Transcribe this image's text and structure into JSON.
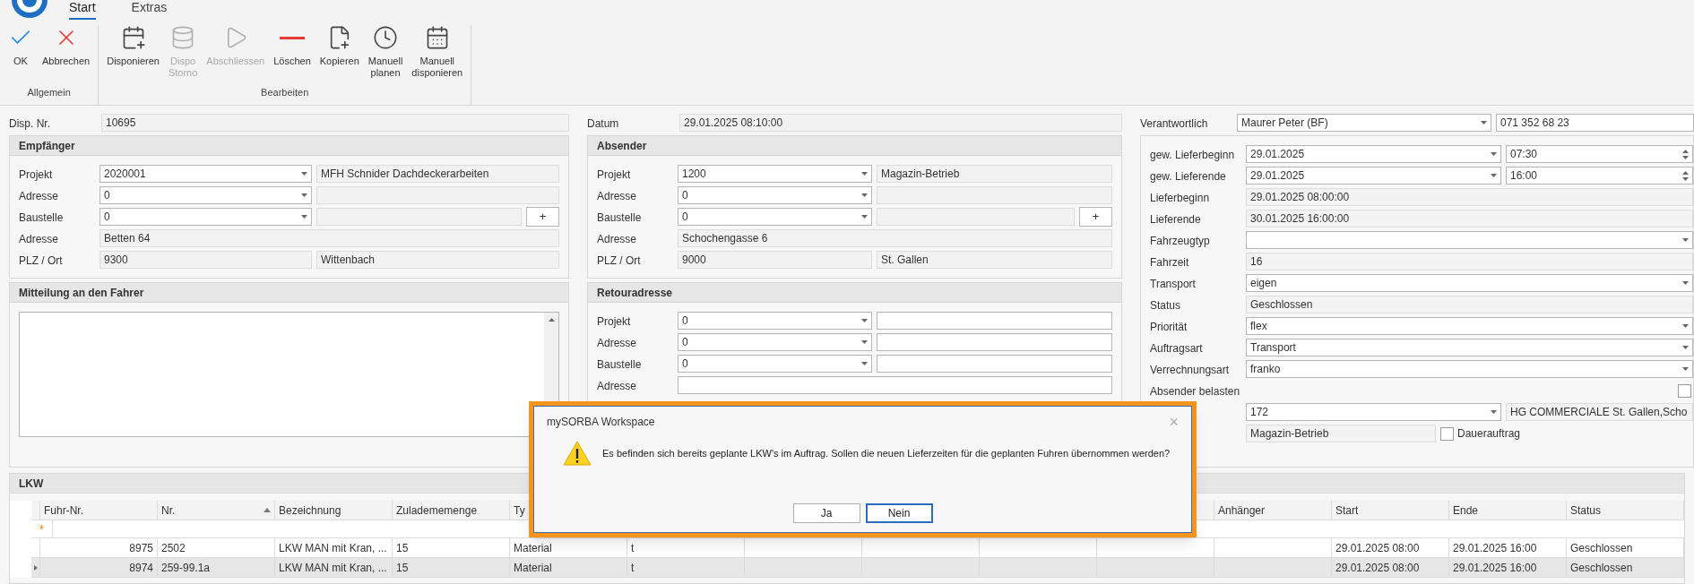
{
  "tabs": [
    {
      "label": "Start",
      "selected": true
    },
    {
      "label": "Extras",
      "selected": false
    }
  ],
  "ribbon": {
    "groups": [
      {
        "label": "Allgemein",
        "buttons": [
          {
            "lines": [
              "OK"
            ],
            "disabled": false
          },
          {
            "lines": [
              "Abbrechen"
            ],
            "disabled": false
          }
        ]
      },
      {
        "label": "Bearbeiten",
        "buttons": [
          {
            "lines": [
              "Disponieren"
            ],
            "disabled": false
          },
          {
            "lines": [
              "Dispo",
              "Storno"
            ],
            "disabled": true
          },
          {
            "lines": [
              "Abschliessen"
            ],
            "disabled": true
          },
          {
            "lines": [
              "Löschen"
            ],
            "disabled": false
          },
          {
            "lines": [
              "Kopieren"
            ],
            "disabled": false
          },
          {
            "lines": [
              "Manuell",
              "planen"
            ],
            "disabled": false
          },
          {
            "lines": [
              "Manuell",
              "disponieren"
            ],
            "disabled": false
          }
        ]
      }
    ]
  },
  "left": {
    "top": {
      "label": "Disp. Nr.",
      "value": "10695"
    },
    "empfaenger": {
      "title": "Empfänger",
      "rows": [
        {
          "label": "Projekt",
          "fields": [
            {
              "kind": "combo",
              "value": "2020001"
            },
            {
              "kind": "readonly",
              "value": "MFH Schnider Dachdeckerarbeiten"
            }
          ]
        },
        {
          "label": "Adresse",
          "fields": [
            {
              "kind": "combo",
              "value": "0"
            },
            {
              "kind": "readonly"
            }
          ]
        },
        {
          "label": "Baustelle",
          "fields": [
            {
              "kind": "combo",
              "value": "0"
            },
            {
              "kind": "readonly"
            }
          ],
          "plus": "+"
        },
        {
          "label": "Adresse",
          "fields": [
            {
              "kind": "readonly",
              "value": "Betten 64"
            }
          ]
        },
        {
          "label": "PLZ / Ort",
          "fields": [
            {
              "kind": "readonly",
              "value": "9300"
            },
            {
              "kind": "readonly",
              "value": "Wittenbach"
            }
          ]
        }
      ]
    },
    "mitteilung": {
      "title": "Mitteilung an den Fahrer"
    }
  },
  "middle": {
    "top": {
      "label": "Datum",
      "value": "29.01.2025 08:10:00"
    },
    "absender": {
      "title": "Absender",
      "rows": [
        {
          "label": "Projekt",
          "fields": [
            {
              "kind": "combo",
              "value": "1200"
            },
            {
              "kind": "readonly",
              "value": "Magazin-Betrieb"
            }
          ]
        },
        {
          "label": "Adresse",
          "fields": [
            {
              "kind": "combo",
              "value": "0"
            },
            {
              "kind": "readonly"
            }
          ]
        },
        {
          "label": "Baustelle",
          "fields": [
            {
              "kind": "combo",
              "value": "0"
            },
            {
              "kind": "readonly"
            }
          ],
          "plus": "+"
        },
        {
          "label": "Adresse",
          "fields": [
            {
              "kind": "readonly",
              "value": "Schochengasse 6"
            }
          ]
        },
        {
          "label": "PLZ / Ort",
          "fields": [
            {
              "kind": "readonly",
              "value": "9000"
            },
            {
              "kind": "readonly",
              "value": "St. Gallen"
            }
          ]
        }
      ]
    },
    "retour": {
      "title": "Retouradresse",
      "rows": [
        {
          "label": "Projekt",
          "fields": [
            {
              "kind": "combo",
              "value": "0"
            },
            {
              "kind": "input"
            }
          ]
        },
        {
          "label": "Adresse",
          "fields": [
            {
              "kind": "combo",
              "value": "0"
            },
            {
              "kind": "input"
            }
          ]
        },
        {
          "label": "Baustelle",
          "fields": [
            {
              "kind": "combo",
              "value": "0"
            },
            {
              "kind": "input"
            }
          ]
        },
        {
          "label": "Adresse",
          "fields": [
            {
              "kind": "input"
            }
          ]
        }
      ]
    }
  },
  "right": {
    "top": {
      "label": "Verantwortlich",
      "fields": [
        {
          "kind": "combo",
          "value": "Maurer Peter (BF)"
        },
        {
          "kind": "input",
          "value": "071 352 68 23"
        }
      ]
    },
    "rows": [
      {
        "label": "gew. Lieferbeginn",
        "fields": [
          {
            "kind": "combo",
            "value": "29.01.2025"
          },
          {
            "kind": "spin",
            "value": "07:30"
          }
        ]
      },
      {
        "label": "gew. Lieferende",
        "fields": [
          {
            "kind": "combo",
            "value": "29.01.2025"
          },
          {
            "kind": "spin",
            "value": "16:00"
          }
        ]
      },
      {
        "label": "Lieferbeginn",
        "fields": [
          {
            "kind": "readonly",
            "value": "29.01.2025 08:00:00"
          }
        ]
      },
      {
        "label": "Lieferende",
        "fields": [
          {
            "kind": "readonly",
            "value": "30.01.2025 16:00:00"
          }
        ]
      },
      {
        "label": "Fahrzeugtyp",
        "fields": [
          {
            "kind": "combo"
          }
        ]
      },
      {
        "label": "Fahrzeit",
        "fields": [
          {
            "kind": "readonly",
            "value": "16"
          }
        ]
      },
      {
        "label": "Transport",
        "fields": [
          {
            "kind": "combo",
            "value": "eigen"
          }
        ]
      },
      {
        "label": "Status",
        "fields": [
          {
            "kind": "readonly",
            "value": "Geschlossen"
          }
        ]
      },
      {
        "label": "Priorität",
        "fields": [
          {
            "kind": "combo",
            "value": "flex"
          }
        ]
      },
      {
        "label": "Auftragsart",
        "fields": [
          {
            "kind": "combo",
            "value": "Transport"
          }
        ]
      },
      {
        "label": "Verrechnungsart",
        "fields": [
          {
            "kind": "combo",
            "value": "franko"
          }
        ]
      },
      {
        "label": "Absender belasten",
        "fields": [
          {
            "kind": "checkbox",
            "checked": false
          }
        ]
      },
      {
        "fields": [
          {
            "kind": "combo",
            "value": "172"
          },
          {
            "kind": "readonly",
            "value": "HG COMMERCIALE St. Gallen,Scho"
          }
        ]
      },
      {
        "fields": [
          {
            "kind": "readonly",
            "value": "Magazin-Betrieb"
          },
          {
            "kind": "checkbox",
            "checked": false,
            "label": "Dauerauftrag"
          }
        ]
      }
    ]
  },
  "lkw": {
    "title": "LKW",
    "new_row_marker": "*",
    "columns": [
      {
        "label": "Fuhr-Nr.",
        "sorted": false
      },
      {
        "label": "Nr.",
        "sorted": true
      },
      {
        "label": "Bezeichnung",
        "sorted": false
      },
      {
        "label": "Zuladememenge",
        "sorted": false
      },
      {
        "label": "Ty",
        "sorted": false
      },
      {},
      {},
      {},
      {},
      {},
      {
        "label": "Anhänger",
        "sorted": false
      },
      {
        "label": "Start",
        "sorted": false
      },
      {
        "label": "Ende",
        "sorted": false
      },
      {
        "label": "Status",
        "sorted": false
      }
    ],
    "rows": [
      {
        "selected": false,
        "cells": [
          {
            "text": "8975"
          },
          {
            "text": "2502"
          },
          {
            "text": "LKW MAN mit Kran, ..."
          },
          {
            "text": "15"
          },
          {
            "text": "Material"
          },
          {
            "text": "t"
          },
          {},
          {},
          {},
          {},
          {},
          {
            "text": "29.01.2025 08:00"
          },
          {
            "text": "29.01.2025 16:00"
          },
          {
            "text": "Geschlossen"
          }
        ]
      },
      {
        "selected": true,
        "cells": [
          {
            "text": "8974"
          },
          {
            "text": "259-99.1a"
          },
          {
            "text": "LKW MAN mit Kran, ..."
          },
          {
            "text": "15"
          },
          {
            "text": "Material"
          },
          {
            "text": "t"
          },
          {},
          {},
          {},
          {},
          {},
          {
            "text": "29.01.2025 08:00"
          },
          {
            "text": "29.01.2025 16:00"
          },
          {
            "text": "Geschlossen"
          }
        ]
      }
    ]
  },
  "dialog": {
    "title": "mySORBA Workspace",
    "close": "×",
    "message": "Es befinden sich bereits geplante LKW's im Auftrag. Sollen die neuen Lieferzeiten für die geplanten Fuhren übernommen werden?",
    "buttons": [
      {
        "label": "Ja",
        "focused": false
      },
      {
        "label": "Nein",
        "focused": true
      }
    ]
  }
}
